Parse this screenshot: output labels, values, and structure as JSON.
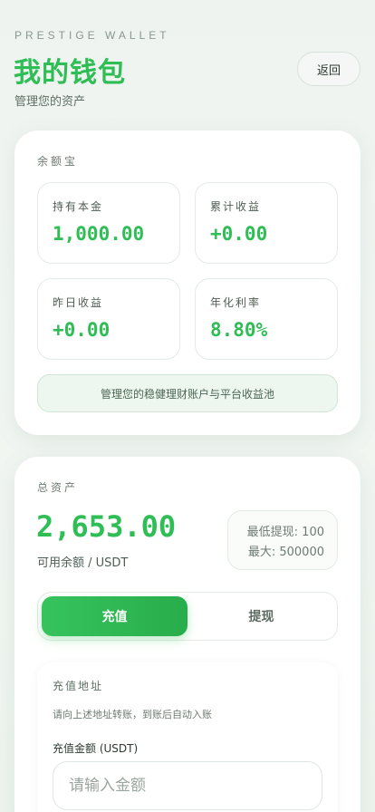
{
  "header": {
    "brand": "PRESTIGE WALLET",
    "title": "我的钱包",
    "subtitle": "管理您的资产",
    "back_label": "返回"
  },
  "yuebao": {
    "section_label": "余额宝",
    "tiles": [
      {
        "label": "持有本金",
        "value": "1,000.00"
      },
      {
        "label": "累计收益",
        "value": "+0.00"
      },
      {
        "label": "昨日收益",
        "value": "+0.00"
      },
      {
        "label": "年化利率",
        "value": "8.80%"
      }
    ],
    "note": "管理您的稳健理财账户与平台收益池"
  },
  "assets": {
    "section_label": "总资产",
    "amount": "2,653.00",
    "available_label": "可用余额 / USDT",
    "min_withdraw": "最低提现: 100",
    "max_withdraw": "最大: 500000",
    "tabs": [
      {
        "label": "充值",
        "active": true
      },
      {
        "label": "提现",
        "active": false
      }
    ]
  },
  "recharge": {
    "address_label": "充值地址",
    "hint": "请向上述地址转账，到账后自动入账",
    "amount_label": "充值金额 (USDT)",
    "amount_value": "",
    "amount_placeholder": "请输入金额"
  },
  "colors": {
    "accent": "#2fbd55",
    "background": "#eef3ef"
  }
}
